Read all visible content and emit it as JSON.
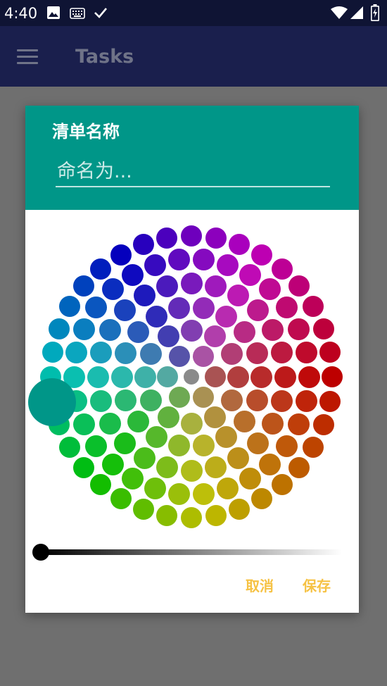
{
  "status_bar": {
    "time": "4:40",
    "left_icons": [
      "image-icon",
      "keyboard-icon",
      "check-icon"
    ],
    "right_icons": [
      "wifi-icon",
      "signal-icon",
      "battery-charging-icon"
    ]
  },
  "app_bar": {
    "title": "Tasks",
    "menu_icon": "menu-icon"
  },
  "dialog": {
    "title": "清单名称",
    "name_input": {
      "placeholder": "命名为...",
      "value": ""
    },
    "selected_color": "#009688",
    "brightness": 0.0,
    "cancel_label": "取消",
    "save_label": "保存"
  },
  "colors": {
    "status_bar": "#0f1434",
    "app_bar": "#1a1f4d",
    "dialog_header": "#009688",
    "accent_button": "#f6c244",
    "scrim": "#6f6f6f"
  }
}
